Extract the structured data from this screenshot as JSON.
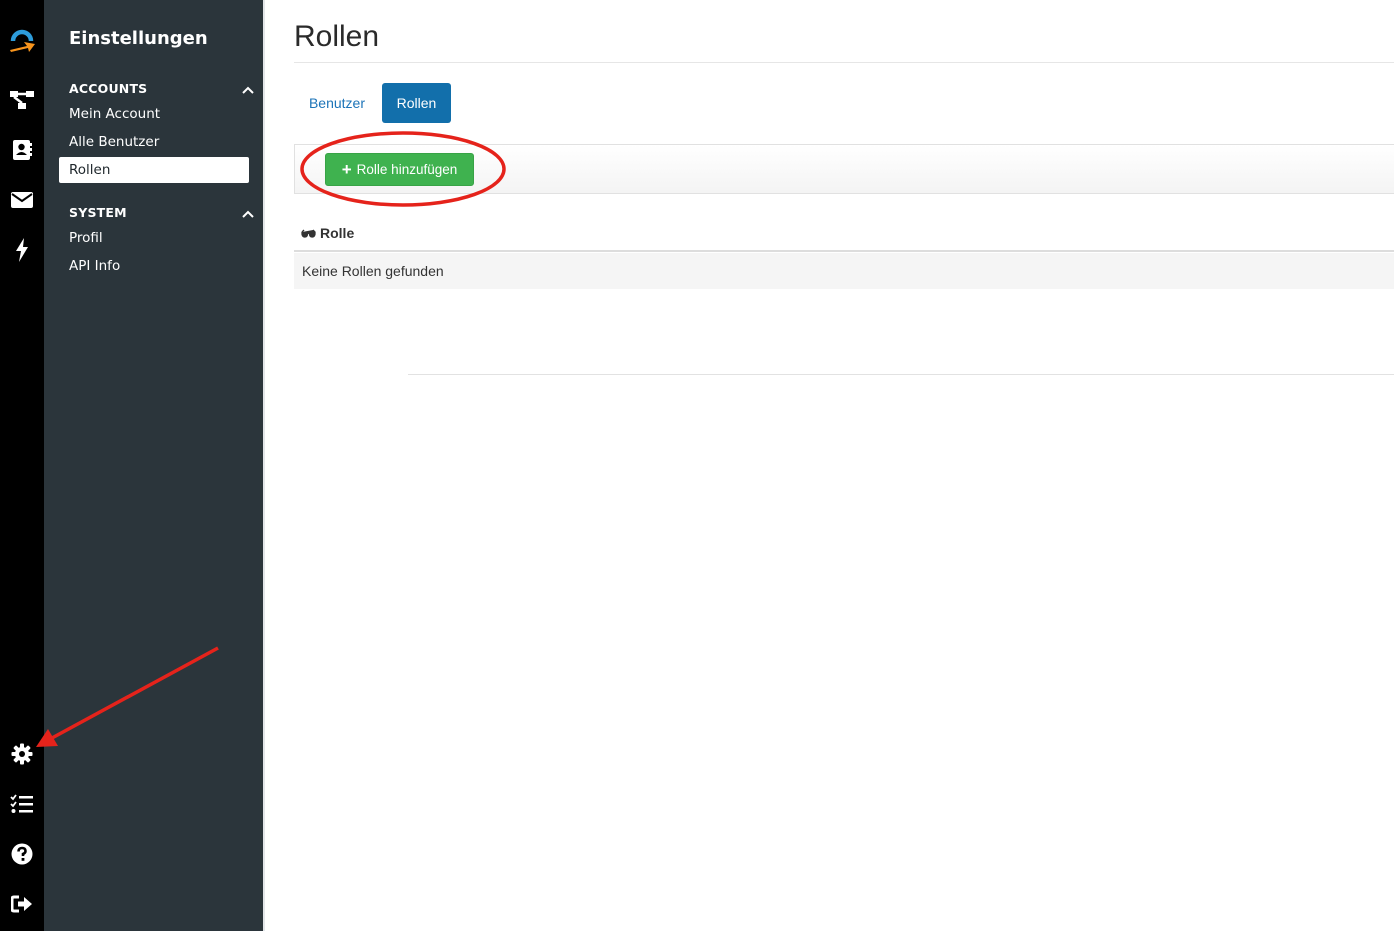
{
  "sidebar": {
    "title": "Einstellungen",
    "sections": [
      {
        "label": "ACCOUNTS",
        "items": [
          {
            "label": "Mein Account"
          },
          {
            "label": "Alle Benutzer"
          },
          {
            "label": "Rollen",
            "active": true
          }
        ]
      },
      {
        "label": "SYSTEM",
        "items": [
          {
            "label": "Profil"
          },
          {
            "label": "API Info"
          }
        ]
      }
    ]
  },
  "rail": {
    "top_icons": [
      "app-logo-icon",
      "workflow-icon",
      "contacts-icon",
      "mail-icon",
      "lightning-icon"
    ],
    "bottom_icons": [
      "gear-icon",
      "checklist-icon",
      "help-icon",
      "sign-out-icon"
    ]
  },
  "main": {
    "title": "Rollen",
    "tabs": [
      {
        "label": "Benutzer",
        "active": false
      },
      {
        "label": "Rollen",
        "active": true
      }
    ],
    "add_button_label": "Rolle hinzufügen",
    "table": {
      "column_header": "Rolle",
      "empty_message": "Keine Rollen gefunden"
    }
  },
  "colors": {
    "rail_bg": "#000000",
    "sidebar_bg": "#2b353b",
    "tab_active": "#126fab",
    "link": "#1d74b8",
    "add_button": "#3fb24f",
    "annotation": "#e5231b",
    "logo_blue": "#2d9cdb",
    "logo_orange": "#f7941d"
  }
}
